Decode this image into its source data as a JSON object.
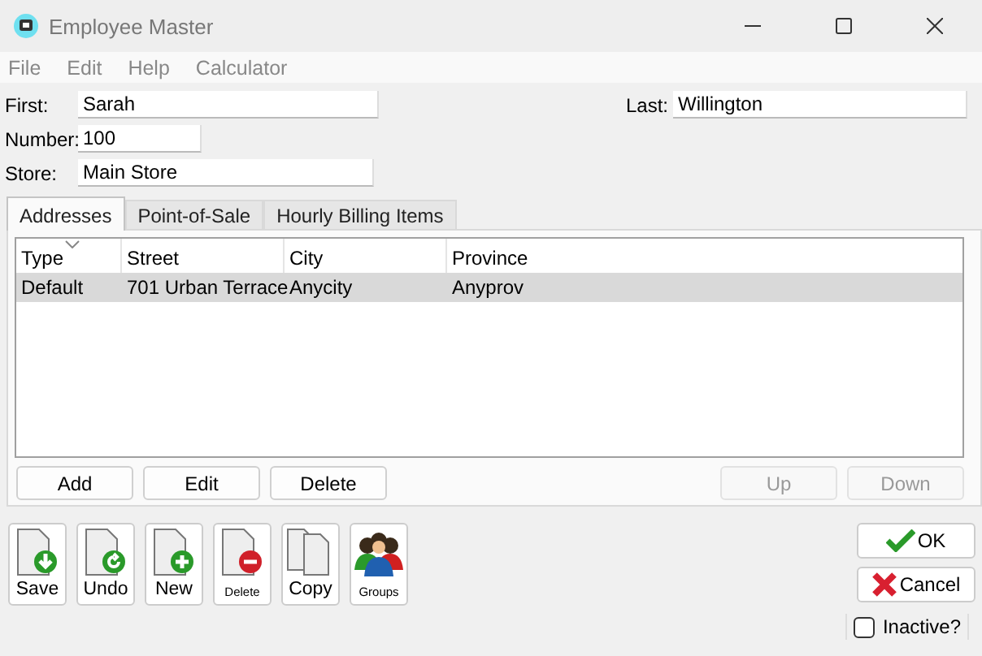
{
  "window": {
    "title": "Employee Master"
  },
  "menu": [
    "File",
    "Edit",
    "Help",
    "Calculator"
  ],
  "fields": {
    "first": {
      "label": "First:",
      "value": "Sarah"
    },
    "last": {
      "label": "Last:",
      "value": "Willington"
    },
    "number": {
      "label": "Number:",
      "value": "100"
    },
    "store": {
      "label": "Store:",
      "value": "Main Store"
    }
  },
  "tabs": [
    {
      "label": "Addresses",
      "selected": true
    },
    {
      "label": "Point-of-Sale",
      "selected": false
    },
    {
      "label": "Hourly Billing Items",
      "selected": false
    }
  ],
  "table": {
    "columns": [
      "Type",
      "Street",
      "City",
      "Province"
    ],
    "rows": [
      {
        "cells": [
          "Default",
          "701 Urban Terrace",
          "Anycity",
          "Anyprov"
        ],
        "selected": true
      }
    ]
  },
  "list_buttons": [
    {
      "label": "Add",
      "disabled": false
    },
    {
      "label": "Edit",
      "disabled": false
    },
    {
      "label": "Delete",
      "disabled": false
    },
    {
      "label": "Up",
      "disabled": true
    },
    {
      "label": "Down",
      "disabled": true
    }
  ],
  "toolbar": [
    {
      "label": "Save",
      "kind": "save"
    },
    {
      "label": "Undo",
      "kind": "undo"
    },
    {
      "label": "New",
      "kind": "new"
    },
    {
      "label": "Delete",
      "kind": "delete"
    },
    {
      "label": "Copy",
      "kind": "copy"
    },
    {
      "label": "Groups",
      "kind": "groups"
    }
  ],
  "ok_button": "OK",
  "cancel_button": "Cancel",
  "inactive": {
    "label": "Inactive?",
    "checked": false
  }
}
